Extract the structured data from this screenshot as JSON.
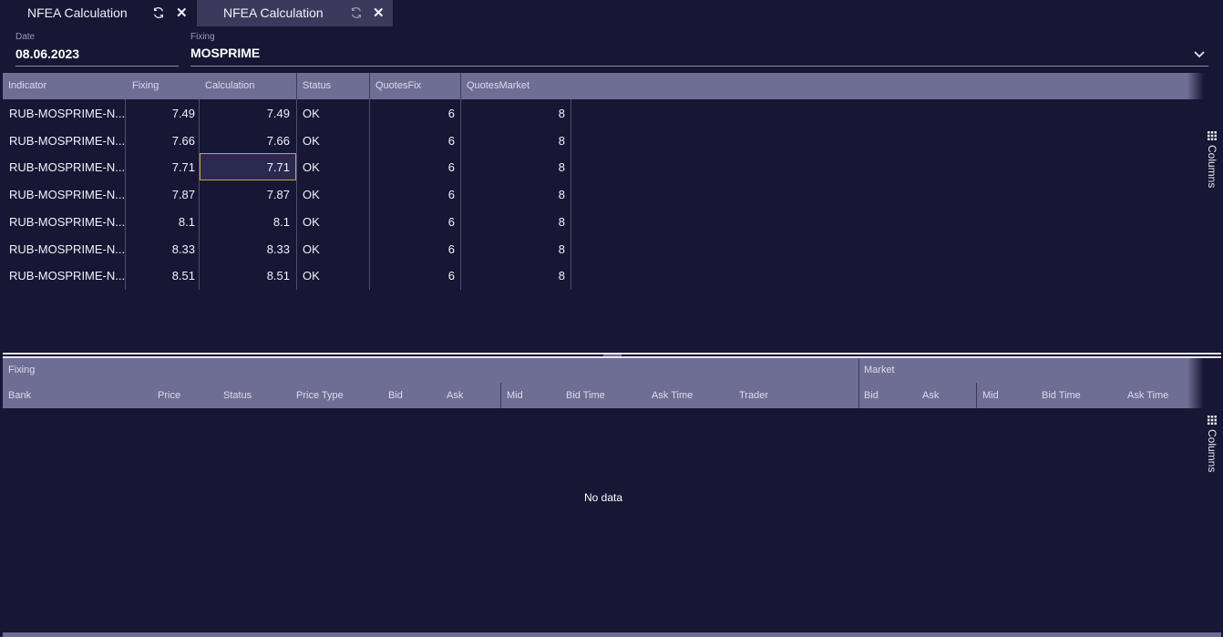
{
  "tabs": [
    {
      "label": "NFEA Calculation",
      "active": true
    },
    {
      "label": "NFEA Calculation",
      "active": false
    }
  ],
  "filters": {
    "date": {
      "label": "Date",
      "value": "08.06.2023"
    },
    "fixing": {
      "label": "Fixing",
      "value": "MOSPRIME"
    }
  },
  "top_grid": {
    "columns": [
      "Indicator",
      "Fixing",
      "Calculation",
      "Status",
      "QuotesFix",
      "QuotesMarket"
    ],
    "rows": [
      {
        "indicator": "RUB-MOSPRIME-N...",
        "fixing": "7.49",
        "calculation": "7.49",
        "status": "OK",
        "quotes_fix": "6",
        "quotes_market": "8"
      },
      {
        "indicator": "RUB-MOSPRIME-N...",
        "fixing": "7.66",
        "calculation": "7.66",
        "status": "OK",
        "quotes_fix": "6",
        "quotes_market": "8"
      },
      {
        "indicator": "RUB-MOSPRIME-N...",
        "fixing": "7.71",
        "calculation": "7.71",
        "status": "OK",
        "quotes_fix": "6",
        "quotes_market": "8"
      },
      {
        "indicator": "RUB-MOSPRIME-N...",
        "fixing": "7.87",
        "calculation": "7.87",
        "status": "OK",
        "quotes_fix": "6",
        "quotes_market": "8"
      },
      {
        "indicator": "RUB-MOSPRIME-N...",
        "fixing": "8.1",
        "calculation": "8.1",
        "status": "OK",
        "quotes_fix": "6",
        "quotes_market": "8"
      },
      {
        "indicator": "RUB-MOSPRIME-N...",
        "fixing": "8.33",
        "calculation": "8.33",
        "status": "OK",
        "quotes_fix": "6",
        "quotes_market": "8"
      },
      {
        "indicator": "RUB-MOSPRIME-N...",
        "fixing": "8.51",
        "calculation": "8.51",
        "status": "OK",
        "quotes_fix": "6",
        "quotes_market": "8"
      }
    ],
    "columns_tool": "Columns"
  },
  "bottom_grid": {
    "groups": [
      "Fixing",
      "Market"
    ],
    "columns": [
      "Bank",
      "Price",
      "Status",
      "Price Type",
      "Bid",
      "Ask",
      "Mid",
      "Bid Time",
      "Ask Time",
      "Trader",
      "Bid",
      "Ask",
      "Mid",
      "Bid Time",
      "Ask Time"
    ],
    "empty_text": "No data",
    "columns_tool": "Columns"
  },
  "colors": {
    "background": "#171634",
    "header": "#6e6d94",
    "selection_border": "#c9a23c"
  }
}
